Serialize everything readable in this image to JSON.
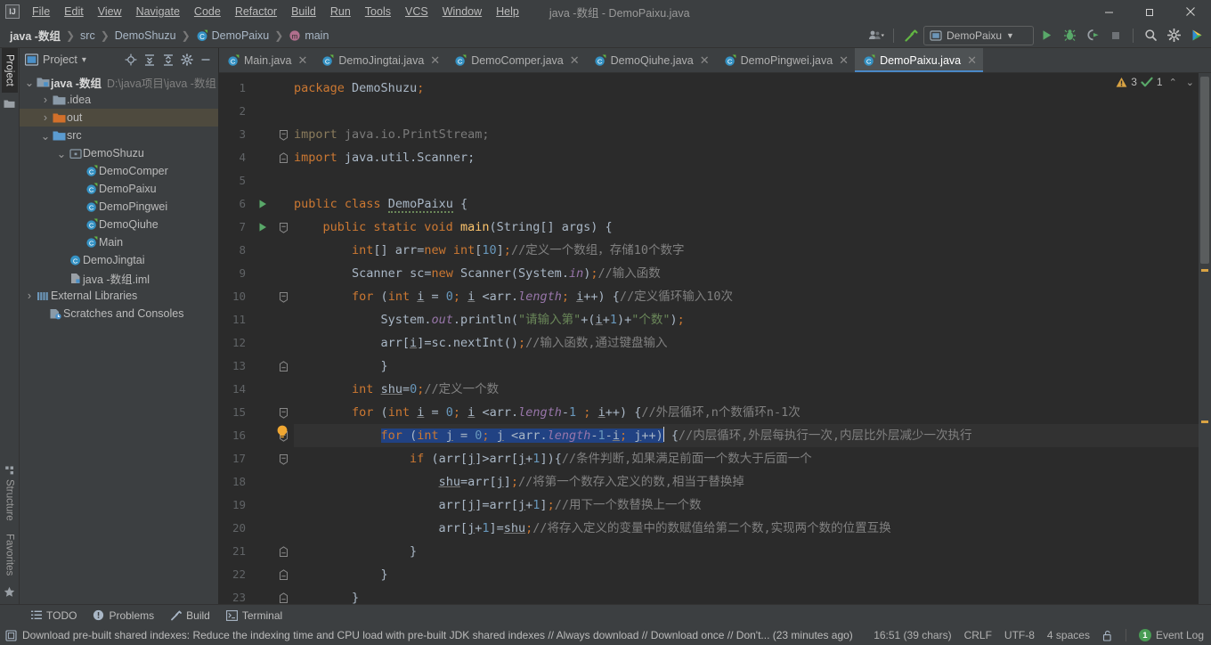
{
  "window": {
    "title": "java -数组 - DemoPaixu.java",
    "logo": "IJ",
    "controls": {
      "minimize": "—",
      "maximize": "❐",
      "close": "✕"
    }
  },
  "menubar": {
    "items": [
      {
        "label": "File"
      },
      {
        "label": "Edit"
      },
      {
        "label": "View"
      },
      {
        "label": "Navigate"
      },
      {
        "label": "Code"
      },
      {
        "label": "Refactor"
      },
      {
        "label": "Build"
      },
      {
        "label": "Run"
      },
      {
        "label": "Tools"
      },
      {
        "label": "VCS"
      },
      {
        "label": "Window"
      },
      {
        "label": "Help"
      }
    ]
  },
  "navbar": {
    "breadcrumbs": [
      {
        "label": "java -数组",
        "icon": "none"
      },
      {
        "label": "src",
        "icon": "none"
      },
      {
        "label": "DemoShuzu",
        "icon": "none"
      },
      {
        "label": "DemoPaixu",
        "icon": "class-icon"
      },
      {
        "label": "main",
        "icon": "method-icon"
      }
    ],
    "separator": "❯",
    "run_configuration": "DemoPaixu",
    "actions": [
      {
        "name": "user-settings-icon"
      },
      {
        "name": "build-hammer-icon"
      },
      {
        "name": "run-icon"
      },
      {
        "name": "debug-icon"
      },
      {
        "name": "run-coverage-icon"
      },
      {
        "name": "stop-icon"
      },
      {
        "name": "search-icon"
      },
      {
        "name": "settings-gear-icon"
      },
      {
        "name": "ide-plugin-icon"
      }
    ]
  },
  "toolstrip": {
    "top": [
      {
        "label": "Project",
        "active": true
      }
    ],
    "bottom": [
      {
        "label": "Structure",
        "active": false
      },
      {
        "label": "Favorites",
        "active": false
      }
    ]
  },
  "project_pane": {
    "title": "Project",
    "dropdown": "▾",
    "header_actions": [
      "locate-icon",
      "expand-all-icon",
      "collapse-all-icon",
      "settings-gear-icon",
      "hide-icon"
    ],
    "tree": [
      {
        "indent": 0,
        "twisty": "v",
        "icon": "module-icon",
        "label": "java -数组",
        "bold": true,
        "path": "D:\\java项目\\java -数组",
        "selected": false
      },
      {
        "indent": 1,
        "twisty": ">",
        "icon": "folder-icon",
        "label": ".idea",
        "bold": false,
        "path": "",
        "selected": false
      },
      {
        "indent": 1,
        "twisty": ">",
        "icon": "folder-out-icon",
        "label": "out",
        "bold": false,
        "path": "",
        "selected": true
      },
      {
        "indent": 1,
        "twisty": "v",
        "icon": "folder-src-icon",
        "label": "src",
        "bold": false,
        "path": "",
        "selected": false
      },
      {
        "indent": 2,
        "twisty": "v",
        "icon": "package-icon",
        "label": "DemoShuzu",
        "bold": false,
        "path": "",
        "selected": false
      },
      {
        "indent": 3,
        "twisty": "",
        "icon": "class-icon",
        "label": "DemoComper",
        "bold": false,
        "path": "",
        "selected": false
      },
      {
        "indent": 3,
        "twisty": "",
        "icon": "class-icon",
        "label": "DemoPaixu",
        "bold": false,
        "path": "",
        "selected": false
      },
      {
        "indent": 3,
        "twisty": "",
        "icon": "class-icon",
        "label": "DemoPingwei",
        "bold": false,
        "path": "",
        "selected": false
      },
      {
        "indent": 3,
        "twisty": "",
        "icon": "class-icon",
        "label": "DemoQiuhe",
        "bold": false,
        "path": "",
        "selected": false
      },
      {
        "indent": 3,
        "twisty": "",
        "icon": "class-icon",
        "label": "Main",
        "bold": false,
        "path": "",
        "selected": false
      },
      {
        "indent": 2,
        "twisty": "",
        "icon": "class-icon",
        "label": "DemoJingtai",
        "bold": false,
        "path": "",
        "selected": false
      },
      {
        "indent": 2,
        "twisty": "",
        "icon": "iml-icon",
        "label": "java -数组.iml",
        "bold": false,
        "path": "",
        "selected": false
      },
      {
        "indent": 0,
        "twisty": ">",
        "icon": "libraries-icon",
        "label": "External Libraries",
        "bold": false,
        "path": "",
        "selected": false
      },
      {
        "indent": 0,
        "twisty": "",
        "icon": "scratches-icon",
        "label": "Scratches and Consoles",
        "bold": false,
        "path": "",
        "selected": false
      }
    ]
  },
  "editor_tabs": {
    "close_glyph": "✕",
    "items": [
      {
        "label": "Main.java",
        "active": false
      },
      {
        "label": "DemoJingtai.java",
        "active": false
      },
      {
        "label": "DemoComper.java",
        "active": false
      },
      {
        "label": "DemoQiuhe.java",
        "active": false
      },
      {
        "label": "DemoPingwei.java",
        "active": false
      },
      {
        "label": "DemoPaixu.java",
        "active": true
      }
    ]
  },
  "inspections": {
    "warning_count": "3",
    "ok_count": "1",
    "up_glyph": "⌃",
    "down_glyph": "⌄"
  },
  "code": {
    "line_numbers": [
      "1",
      "2",
      "3",
      "4",
      "5",
      "6",
      "7",
      "8",
      "9",
      "10",
      "11",
      "12",
      "13",
      "14",
      "15",
      "16",
      "17",
      "18",
      "19",
      "20",
      "21",
      "22",
      "23"
    ],
    "lines": [
      {
        "n": "1",
        "text": "package DemoShuzu;"
      },
      {
        "n": "2",
        "text": ""
      },
      {
        "n": "3",
        "text": "import java.io.PrintStream;"
      },
      {
        "n": "4",
        "text": "import java.util.Scanner;"
      },
      {
        "n": "5",
        "text": ""
      },
      {
        "n": "6",
        "text": "public class DemoPaixu {"
      },
      {
        "n": "7",
        "text": "    public static void main(String[] args) {"
      },
      {
        "n": "8",
        "text": "        int[] arr=new int[10];//定义一个数组，存储10个数字"
      },
      {
        "n": "9",
        "text": "        Scanner sc=new Scanner(System.in);//输入函数"
      },
      {
        "n": "10",
        "text": "        for (int i = 0; i <arr.length; i++) {//定义循环输入10次"
      },
      {
        "n": "11",
        "text": "            System.out.println(\"请输入第\"+(i+1)+\"个数\");"
      },
      {
        "n": "12",
        "text": "            arr[i]=sc.nextInt();//输入函数,通过键盘输入"
      },
      {
        "n": "13",
        "text": "            }"
      },
      {
        "n": "14",
        "text": "        int shu=0;//定义一个数"
      },
      {
        "n": "15",
        "text": "        for (int i = 0; i <arr.length-1 ; i++) {//外层循环,n个数循环n-1次"
      },
      {
        "n": "16",
        "text": "            for (int j = 0; j <arr.length-1-i; j++) {//内层循环,外层每执行一次,内层比外层减少一次执行"
      },
      {
        "n": "17",
        "text": "                if (arr[j]>arr[j+1]){//条件判断,如果满足前面一个数大于后面一个"
      },
      {
        "n": "18",
        "text": "                    shu=arr[j];//将第一个数存入定义的数,相当于替换掉"
      },
      {
        "n": "19",
        "text": "                    arr[j]=arr[j+1];//用下一个数替换上一个数"
      },
      {
        "n": "20",
        "text": "                    arr[j+1]=shu;//将存入定义的变量中的数赋值给第二个数,实现两个数的位置互换"
      },
      {
        "n": "21",
        "text": "                }"
      },
      {
        "n": "22",
        "text": "            }"
      },
      {
        "n": "23",
        "text": "        }"
      }
    ],
    "selection_line": "16",
    "selected_text": "for (int j = 0; j <arr.length-1-i; j++)",
    "bulb_line": "16"
  },
  "bottom_tabs": {
    "items": [
      {
        "label": "TODO",
        "icon": "todo-icon"
      },
      {
        "label": "Problems",
        "icon": "problems-icon"
      },
      {
        "label": "Build",
        "icon": "build-icon"
      },
      {
        "label": "Terminal",
        "icon": "terminal-icon"
      }
    ]
  },
  "statusbar": {
    "message": "Download pre-built shared indexes: Reduce the indexing time and CPU load with pre-built JDK shared indexes // Always download // Download once // Don't... (23 minutes ago)",
    "caret_position": "16:51 (39 chars)",
    "line_separator": "CRLF",
    "encoding": "UTF-8",
    "indent": "4 spaces",
    "lock_icon": "unlocked-icon",
    "event_log": "Event Log",
    "event_log_count": "1"
  },
  "colors": {
    "bg_chrome": "#3c3f41",
    "bg_editor": "#2b2b2b",
    "accent_blue": "#4a88c7",
    "selection": "#214283",
    "keyword": "#cc7832",
    "string": "#6a8759",
    "number": "#6897bb",
    "comment": "#808080",
    "method": "#ffc66d",
    "field": "#9876aa",
    "text": "#a9b7c6",
    "tree_selected": "#4e4a3e",
    "warning": "#d9a343",
    "ok_green": "#499c54"
  }
}
